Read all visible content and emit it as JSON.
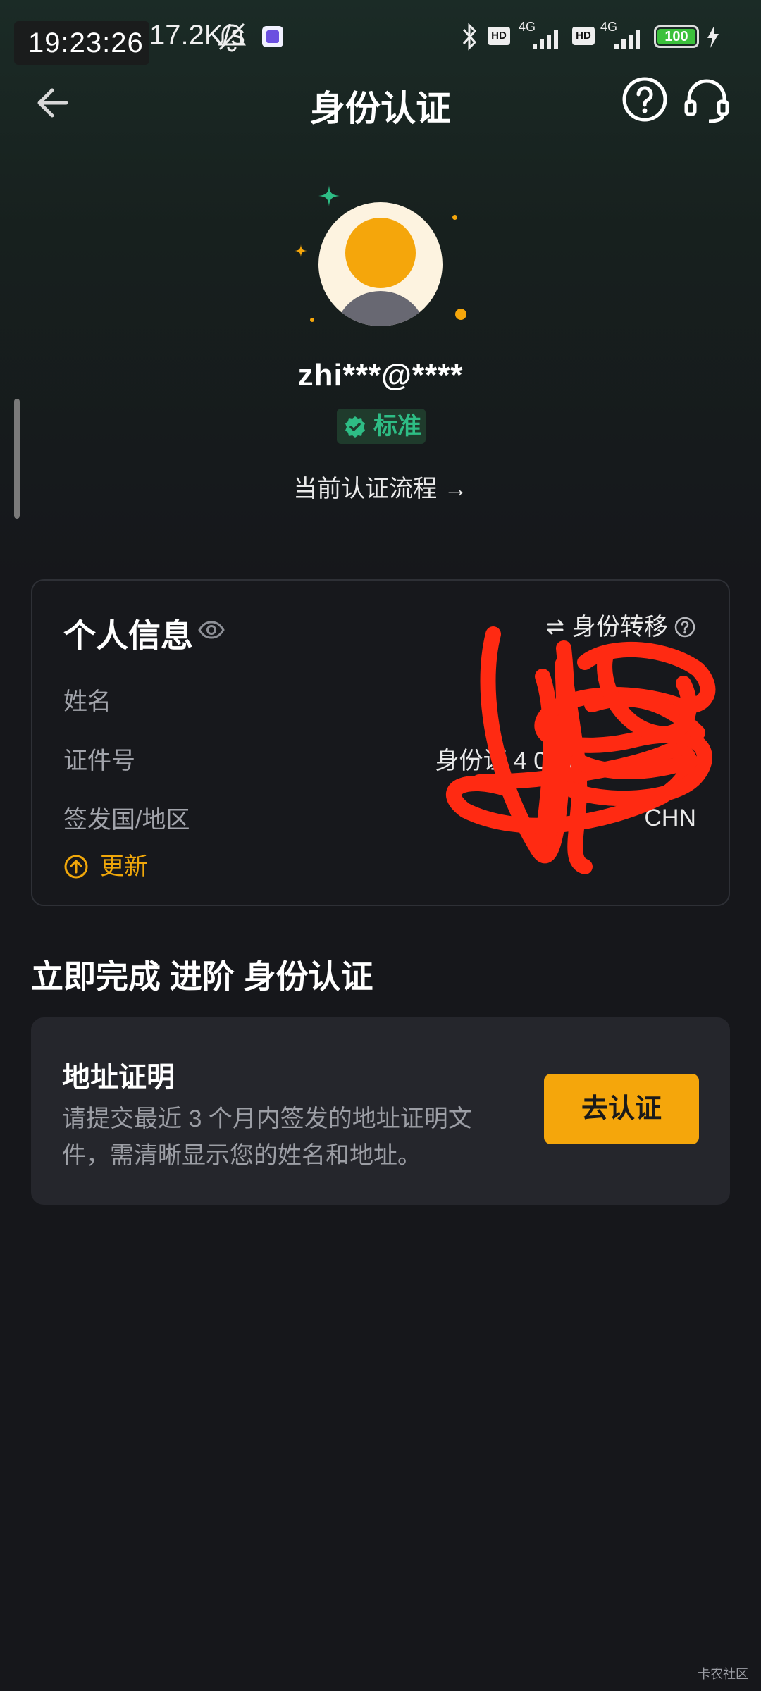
{
  "status_bar": {
    "time": "19:23:26",
    "net_speed": "17.2K/s",
    "battery": "100",
    "network_1": "4G",
    "network_2": "4G",
    "hd_1": "HD",
    "hd_2": "HD"
  },
  "header": {
    "title": "身份认证"
  },
  "profile": {
    "username": "zhi***@****",
    "level_badge": "标准",
    "flow_link": "当前认证流程 →"
  },
  "personal_info": {
    "title": "个人信息",
    "transfer_label": "身份转移",
    "rows": [
      {
        "label": "姓名",
        "value": ""
      },
      {
        "label": "证件号",
        "value": "身份证 4 028"
      },
      {
        "label": "签发国/地区",
        "value": "CHN"
      }
    ],
    "update_label": "更新"
  },
  "advance": {
    "section_title": "立即完成 进阶 身份认证",
    "card_title": "地址证明",
    "card_desc": "请提交最近 3 个月内签发的地址证明文件，需清晰显示您的姓名和地址。",
    "button_label": "去认证"
  },
  "watermark": "卡农社区",
  "colors": {
    "accent": "#f5a60b",
    "badge_green": "#2ebd85",
    "scribble": "#ff2a12"
  }
}
